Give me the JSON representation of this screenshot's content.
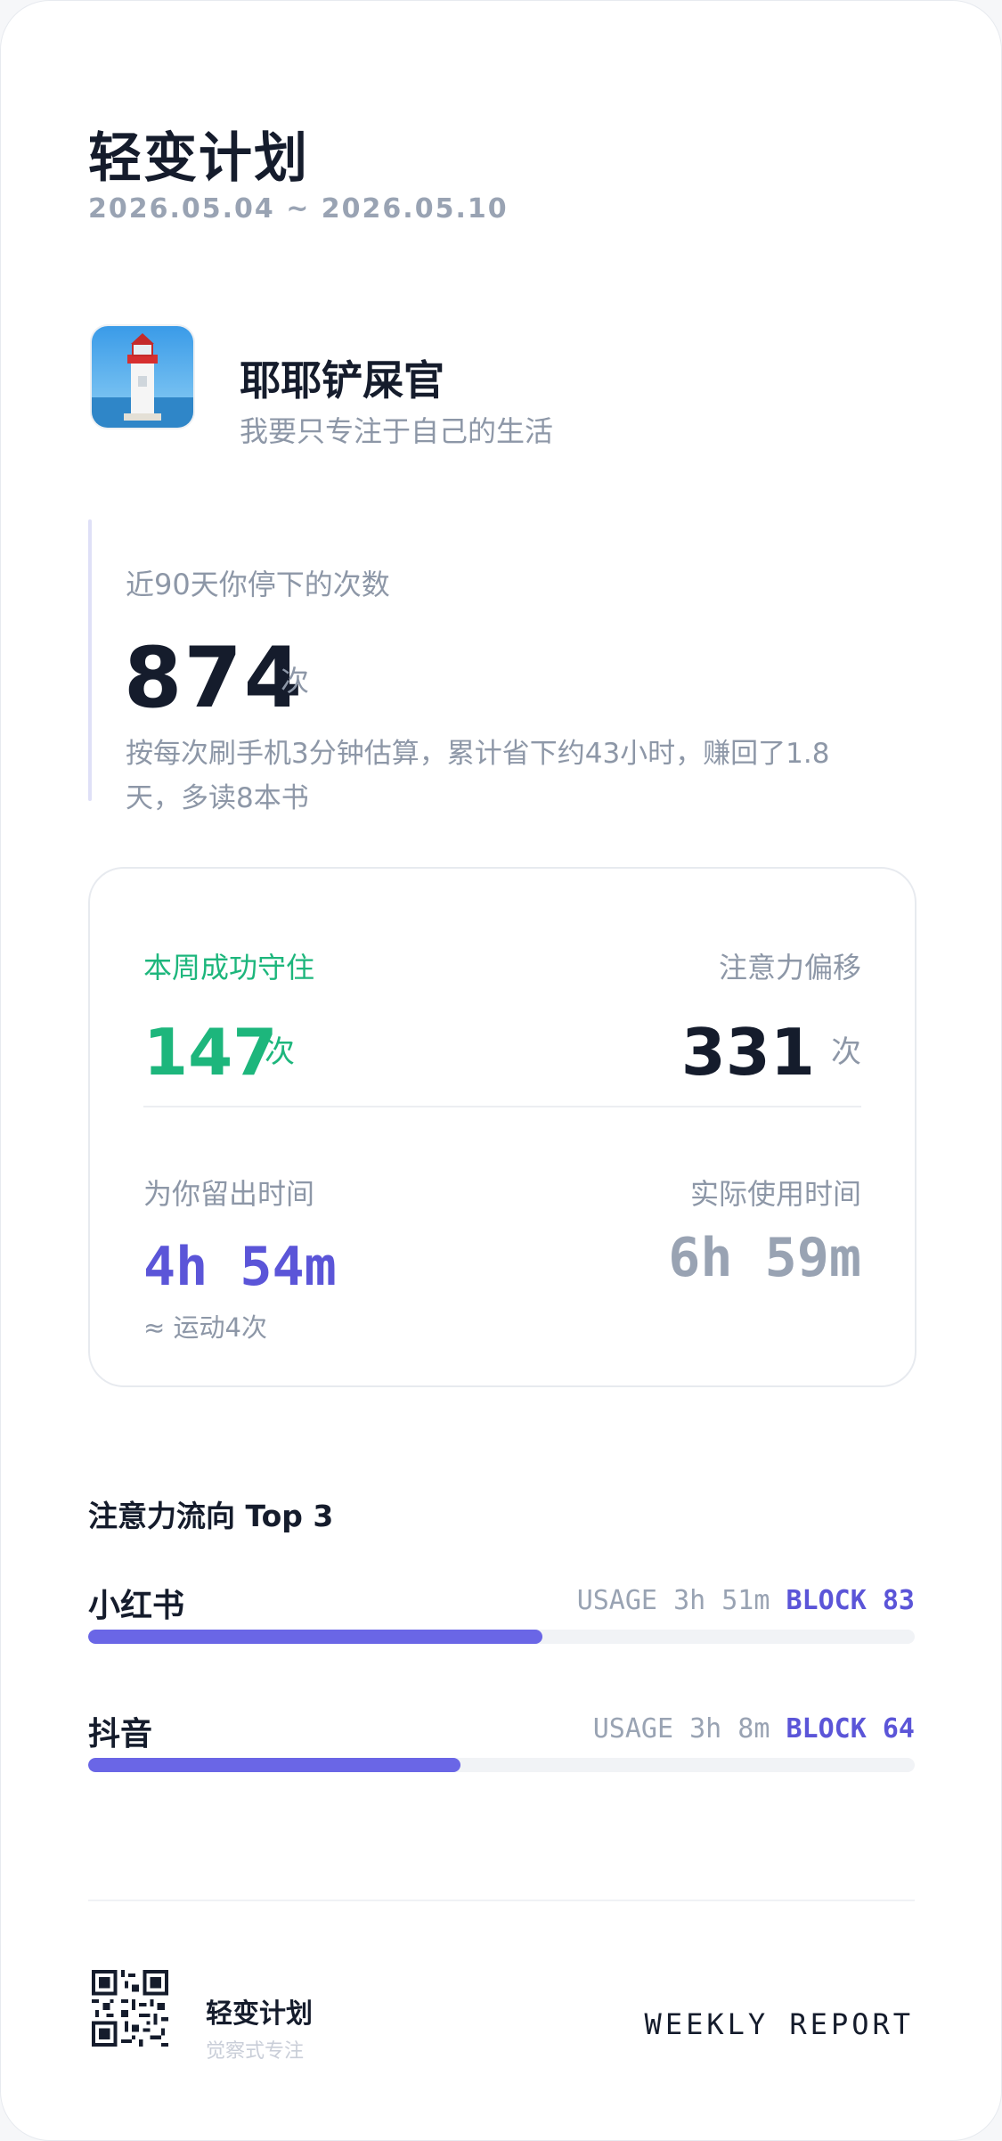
{
  "header": {
    "title": "轻变计划",
    "date_range": "2026.05.04 ~ 2026.05.10"
  },
  "profile": {
    "name": "耶耶铲屎官",
    "motto": "我要只专注于自己的生活",
    "avatar_icon": "lighthouse-avatar"
  },
  "stop_stat": {
    "label": "近90天你停下的次数",
    "count": "874",
    "unit": "次",
    "description": "按每次刷手机3分钟估算，累计省下约43小时，赚回了1.8天，多读8本书"
  },
  "weekly": {
    "held_label": "本周成功守住",
    "held_count": "147",
    "held_unit": "次",
    "drift_label": "注意力偏移",
    "drift_count": "331",
    "drift_unit": "次",
    "saved_label": "为你留出时间",
    "saved_time": "4h 54m",
    "saved_note": "≈ 运动4次",
    "used_label": "实际使用时间",
    "used_time": "6h 59m"
  },
  "top_apps": {
    "title": "注意力流向 Top 3",
    "items": [
      {
        "name": "小红书",
        "usage_label": "USAGE",
        "usage": "3h 51m",
        "block_label": "BLOCK",
        "block": "83",
        "bar_fraction": 0.55
      },
      {
        "name": "抖音",
        "usage_label": "USAGE",
        "usage": "3h 8m",
        "block_label": "BLOCK",
        "block": "64",
        "bar_fraction": 0.45
      }
    ]
  },
  "footer": {
    "brand": "轻变计划",
    "tagline": "觉察式专注",
    "report": "WEEKLY REPORT",
    "qr_icon": "qr-code-icon"
  },
  "colors": {
    "accent_green": "#1db67c",
    "accent_indigo": "#5b55d8",
    "bar_fill": "#6a66e6",
    "muted": "#8d97a7"
  }
}
